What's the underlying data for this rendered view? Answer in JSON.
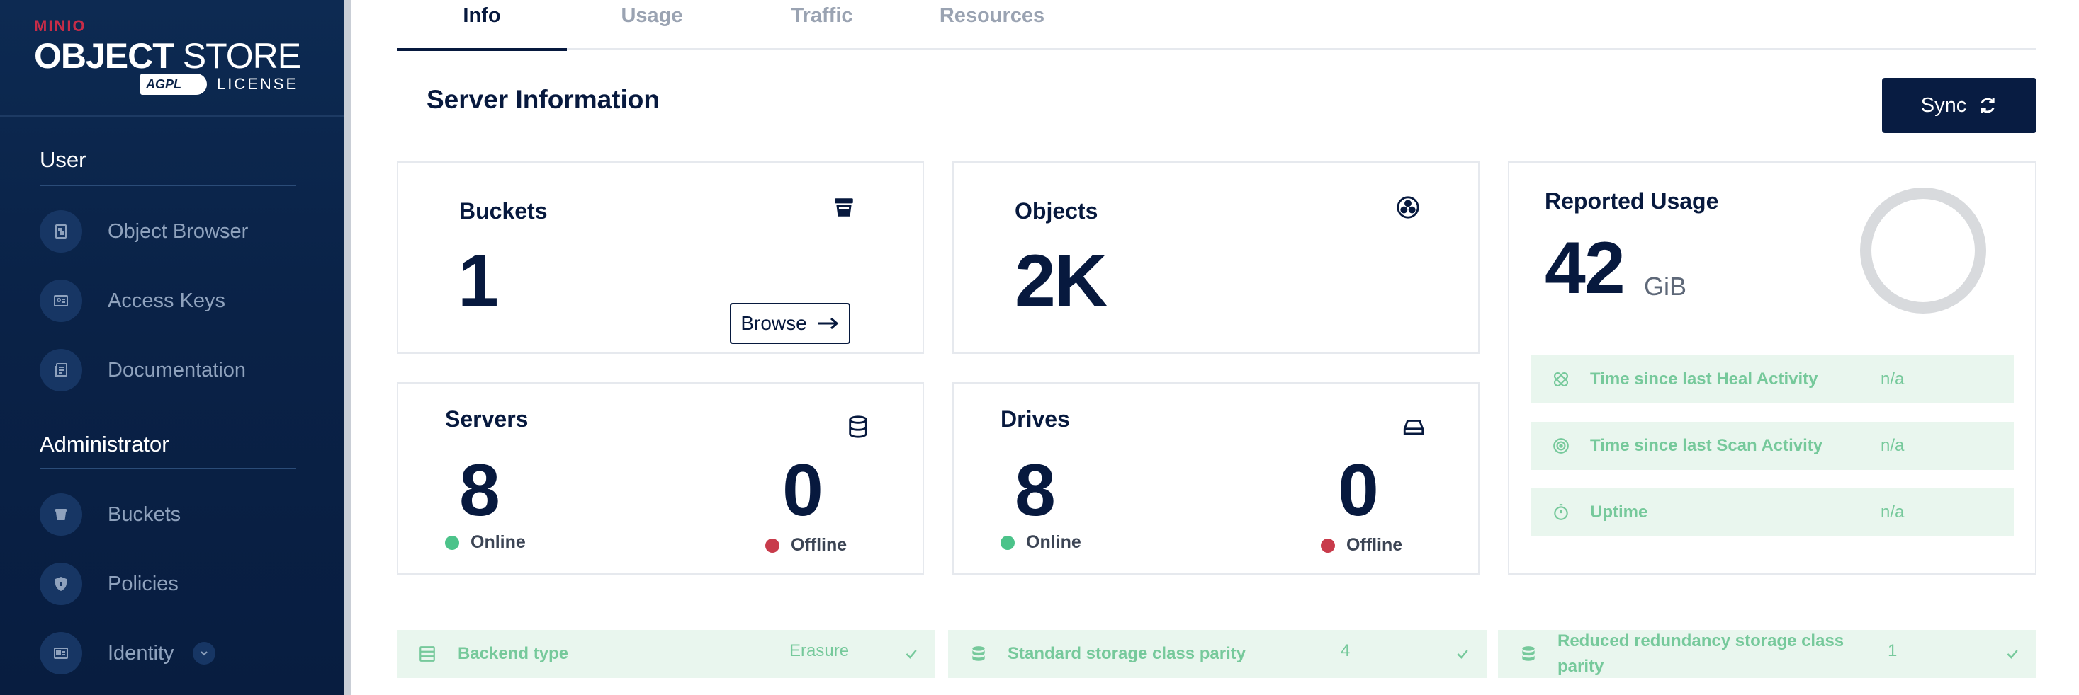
{
  "sidebar": {
    "logo": {
      "brand": "MINIO",
      "product_bold": "OBJECT",
      "product_thin": "STORE",
      "badge": "AGPL",
      "license": "LICENSE"
    },
    "user_section": "User",
    "user_items": [
      {
        "label": "Object Browser",
        "icon": "object-browser-icon"
      },
      {
        "label": "Access Keys",
        "icon": "access-keys-icon"
      },
      {
        "label": "Documentation",
        "icon": "documentation-icon"
      }
    ],
    "admin_section": "Administrator",
    "admin_items": [
      {
        "label": "Buckets",
        "icon": "bucket-icon"
      },
      {
        "label": "Policies",
        "icon": "shield-icon"
      },
      {
        "label": "Identity",
        "icon": "id-card-icon"
      }
    ]
  },
  "tabs": [
    {
      "label": "Info",
      "active": true
    },
    {
      "label": "Usage",
      "active": false
    },
    {
      "label": "Traffic",
      "active": false
    },
    {
      "label": "Resources",
      "active": false
    }
  ],
  "page_title": "Server Information",
  "sync_label": "Sync",
  "buckets": {
    "title": "Buckets",
    "value": "1",
    "browse_label": "Browse"
  },
  "objects": {
    "title": "Objects",
    "value": "2K"
  },
  "servers": {
    "title": "Servers",
    "online": "8",
    "online_label": "Online",
    "offline": "0",
    "offline_label": "Offline"
  },
  "drives": {
    "title": "Drives",
    "online": "8",
    "online_label": "Online",
    "offline": "0",
    "offline_label": "Offline"
  },
  "reported_usage": {
    "title": "Reported Usage",
    "value": "42",
    "unit": "GiB",
    "rows": [
      {
        "label": "Time since last Heal Activity",
        "value": "n/a",
        "icon": "heal-icon"
      },
      {
        "label": "Time since last Scan Activity",
        "value": "n/a",
        "icon": "scan-icon"
      },
      {
        "label": "Uptime",
        "value": "n/a",
        "icon": "timer-icon"
      }
    ]
  },
  "bottom": [
    {
      "label": "Backend type",
      "value": "Erasure",
      "icon": "backend-icon"
    },
    {
      "label": "Standard storage class parity",
      "value": "4",
      "icon": "storage-icon"
    },
    {
      "label": "Reduced redundancy storage class parity",
      "value": "1",
      "icon": "storage-icon"
    }
  ],
  "colors": {
    "navy": "#07193e",
    "sidebar": "#0a2247",
    "green_bg": "#e9f6ee",
    "green_text": "#76c99b",
    "online": "#4cc38a",
    "offline": "#c83b4b"
  }
}
